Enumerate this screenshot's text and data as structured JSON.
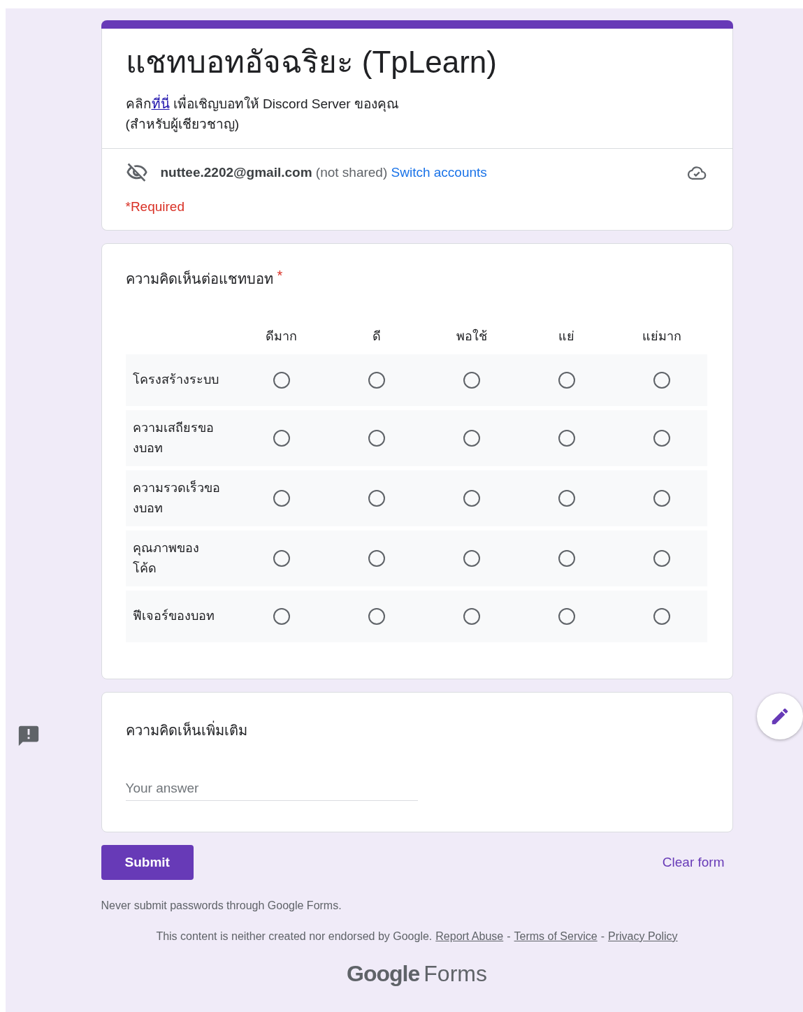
{
  "header": {
    "title": "แชทบอทอัจฉริยะ (TpLearn)",
    "description": {
      "before": "คลิก",
      "link": "ที่นี่",
      "after": " เพื่อเชิญบอทให้ Discord Server ของคุณ",
      "line2": "(สำหรับผู้เชียวชาญ)"
    },
    "email": "nuttee.2202@gmail.com",
    "not_shared": "(not shared)",
    "switch_accounts": "Switch accounts",
    "required_note": "*Required"
  },
  "grid_question": {
    "title": "ความคิดเห็นต่อแชทบอท",
    "required_mark": "*",
    "columns": [
      "ดีมาก",
      "ดี",
      "พอใช้",
      "แย่",
      "แย่มาก"
    ],
    "rows": [
      {
        "label": "โครงสร้างระบบ",
        "choices": [
          {
            "selected": false
          },
          {
            "selected": false
          },
          {
            "selected": false
          },
          {
            "selected": false
          },
          {
            "selected": false
          }
        ]
      },
      {
        "label": "ความเสถียรขอ\nงบอท",
        "choices": [
          {
            "selected": false
          },
          {
            "selected": false
          },
          {
            "selected": false
          },
          {
            "selected": false
          },
          {
            "selected": false
          }
        ]
      },
      {
        "label": "ความรวดเร็วขอ\nงบอท",
        "choices": [
          {
            "selected": false
          },
          {
            "selected": false
          },
          {
            "selected": false
          },
          {
            "selected": false
          },
          {
            "selected": false
          }
        ]
      },
      {
        "label": "คุณภาพของ\nโค้ด",
        "choices": [
          {
            "selected": false
          },
          {
            "selected": false
          },
          {
            "selected": false
          },
          {
            "selected": false
          },
          {
            "selected": false
          }
        ]
      },
      {
        "label": "ฟีเจอร์ของบอท",
        "choices": [
          {
            "selected": false
          },
          {
            "selected": false
          },
          {
            "selected": false
          },
          {
            "selected": false
          },
          {
            "selected": false
          }
        ]
      }
    ]
  },
  "text_question": {
    "title": "ความคิดเห็นเพิ่มเติม",
    "placeholder": "Your answer"
  },
  "actions": {
    "submit": "Submit",
    "clear": "Clear form"
  },
  "footer": {
    "warning": "Never submit passwords through Google Forms.",
    "disclaimer": "This content is neither created nor endorsed by Google.",
    "links": [
      "Report Abuse",
      "Terms of Service",
      "Privacy Policy"
    ],
    "separator": "-",
    "logo_main": "Google",
    "logo_product": "Forms"
  }
}
